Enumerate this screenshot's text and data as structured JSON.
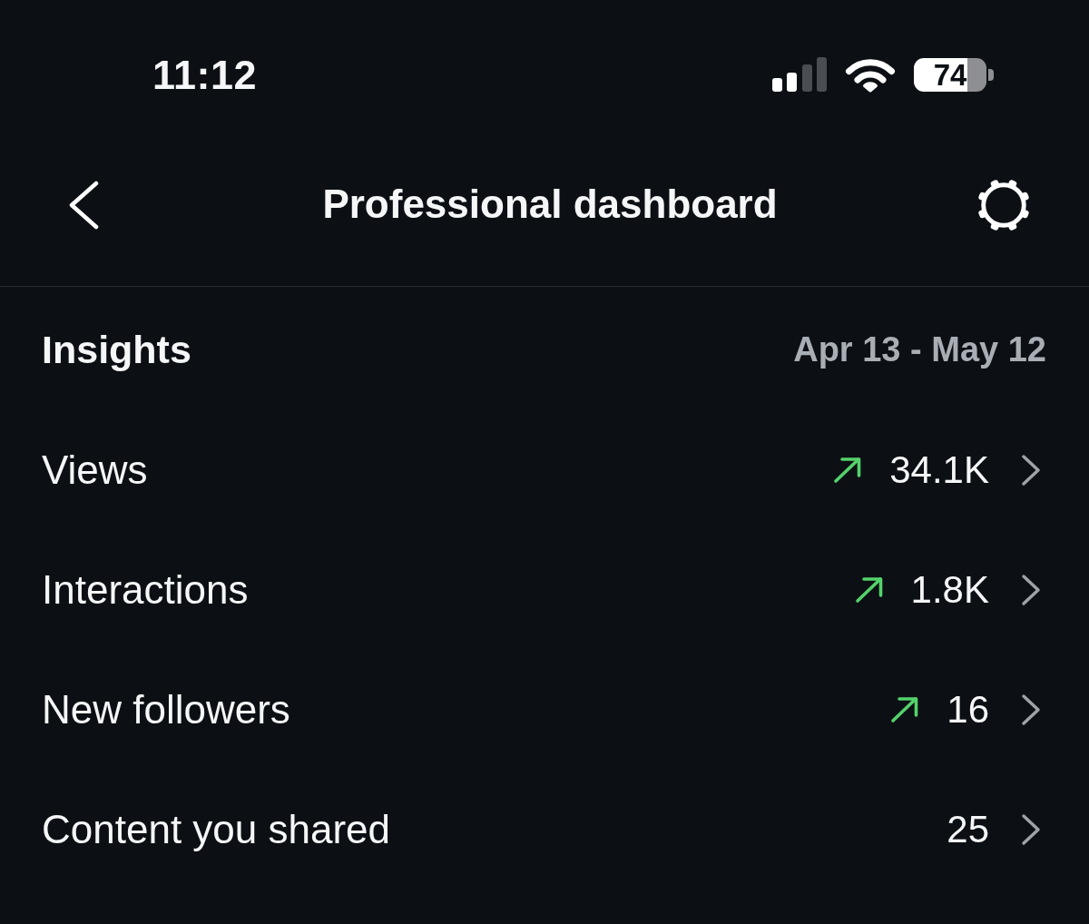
{
  "status_bar": {
    "time": "11:12",
    "battery": "74"
  },
  "header": {
    "title": "Professional dashboard"
  },
  "insights": {
    "title": "Insights",
    "date_range": "Apr 13 - May 12",
    "metrics": [
      {
        "label": "Views",
        "trending_up": true,
        "value": "34.1K"
      },
      {
        "label": "Interactions",
        "trending_up": true,
        "value": "1.8K"
      },
      {
        "label": "New followers",
        "trending_up": true,
        "value": "16"
      },
      {
        "label": "Content you shared",
        "trending_up": false,
        "value": "25"
      }
    ]
  }
}
